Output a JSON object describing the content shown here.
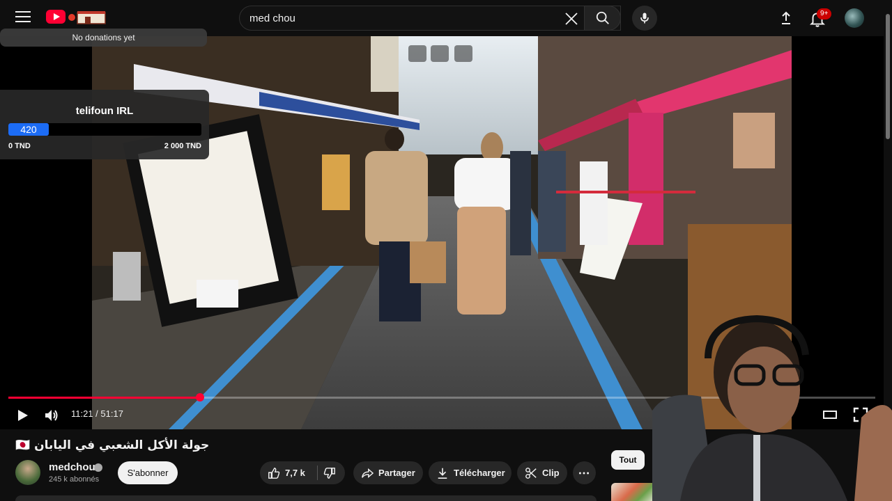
{
  "header": {
    "search_value": "med chou",
    "notification_badge": "9+"
  },
  "overlay": {
    "donation_banner": "No donations yet",
    "goal": {
      "title": "telifoun IRL",
      "current": "420",
      "min_label": "0 TND",
      "max_label": "2 000 TND",
      "progress_fraction": 0.21
    }
  },
  "player": {
    "time": "11:21 / 51:17",
    "progress_fraction": 0.2214,
    "accent_color": "#ff0033"
  },
  "video": {
    "title": "جولة الأكل الشعبي في اليابان 🇯🇵",
    "channel_name": "medchou",
    "subscribers": "245 k abonnés",
    "subscribe_label": "S'abonner",
    "likes": "7,7 k",
    "share_label": "Partager",
    "download_label": "Télécharger",
    "clip_label": "Clip"
  },
  "sidebar": {
    "chip_all": "Tout"
  },
  "icons": [
    "menu-icon",
    "youtube-logo-icon",
    "close-icon",
    "search-icon",
    "microphone-icon",
    "upload-icon",
    "bell-icon",
    "play-icon",
    "volume-icon",
    "theater-mode-icon",
    "fullscreen-icon",
    "like-icon",
    "dislike-icon",
    "share-icon",
    "download-icon",
    "scissors-icon",
    "more-icon",
    "chevron-right-icon",
    "verified-icon"
  ]
}
